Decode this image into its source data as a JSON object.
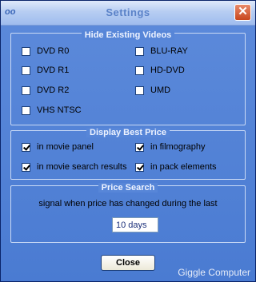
{
  "window": {
    "title": "Settings",
    "close_glyph": "✕",
    "app_icon": "oo"
  },
  "hide_videos": {
    "legend": "Hide Existing Videos",
    "options": [
      {
        "label": "DVD R0",
        "checked": false
      },
      {
        "label": "BLU-RAY",
        "checked": false
      },
      {
        "label": "DVD R1",
        "checked": false
      },
      {
        "label": "HD-DVD",
        "checked": false
      },
      {
        "label": "DVD R2",
        "checked": false
      },
      {
        "label": "UMD",
        "checked": false
      },
      {
        "label": "VHS NTSC",
        "checked": false
      }
    ]
  },
  "best_price": {
    "legend": "Display Best Price",
    "options": [
      {
        "label": "in movie panel",
        "checked": true
      },
      {
        "label": "in filmography",
        "checked": true
      },
      {
        "label": "in movie search results",
        "checked": true
      },
      {
        "label": "in pack elements",
        "checked": true
      }
    ]
  },
  "price_search": {
    "legend": "Price Search",
    "description": "signal when price has changed during the last",
    "value": "10 days"
  },
  "buttons": {
    "close": "Close"
  },
  "watermark": "Giggle Computer"
}
